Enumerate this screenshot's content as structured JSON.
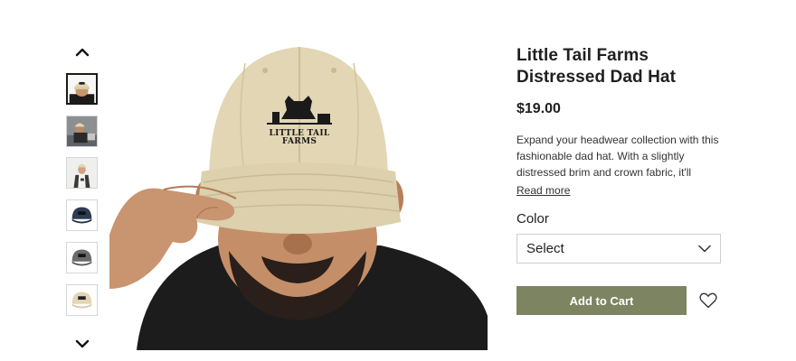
{
  "gallery": {
    "thumbnails": [
      {
        "icon": "thumbnail-man-beige-hat",
        "selected": true
      },
      {
        "icon": "thumbnail-man-crouching-beige-hat",
        "selected": false
      },
      {
        "icon": "thumbnail-woman-beige-hat",
        "selected": false
      },
      {
        "icon": "thumbnail-navy-hat",
        "selected": false
      },
      {
        "icon": "thumbnail-grey-hat",
        "selected": false
      },
      {
        "icon": "thumbnail-beige-hat",
        "selected": false
      }
    ],
    "hat_logo_text": "LITTLE TAIL FARMS"
  },
  "product": {
    "title": "Little Tail Farms Distressed Dad Hat",
    "price": "$19.00",
    "description": "Expand your headwear collection with this fashionable dad hat. With a slightly distressed brim and crown fabric, it'll",
    "read_more_label": "Read more",
    "color_label": "Color",
    "color_select_value": "Select",
    "add_to_cart_label": "Add to Cart"
  },
  "colors": {
    "accent": "#7c8462",
    "hat_khaki": "#e2d6b4",
    "navy": "#2d3b55",
    "grey": "#6b6b6b"
  }
}
